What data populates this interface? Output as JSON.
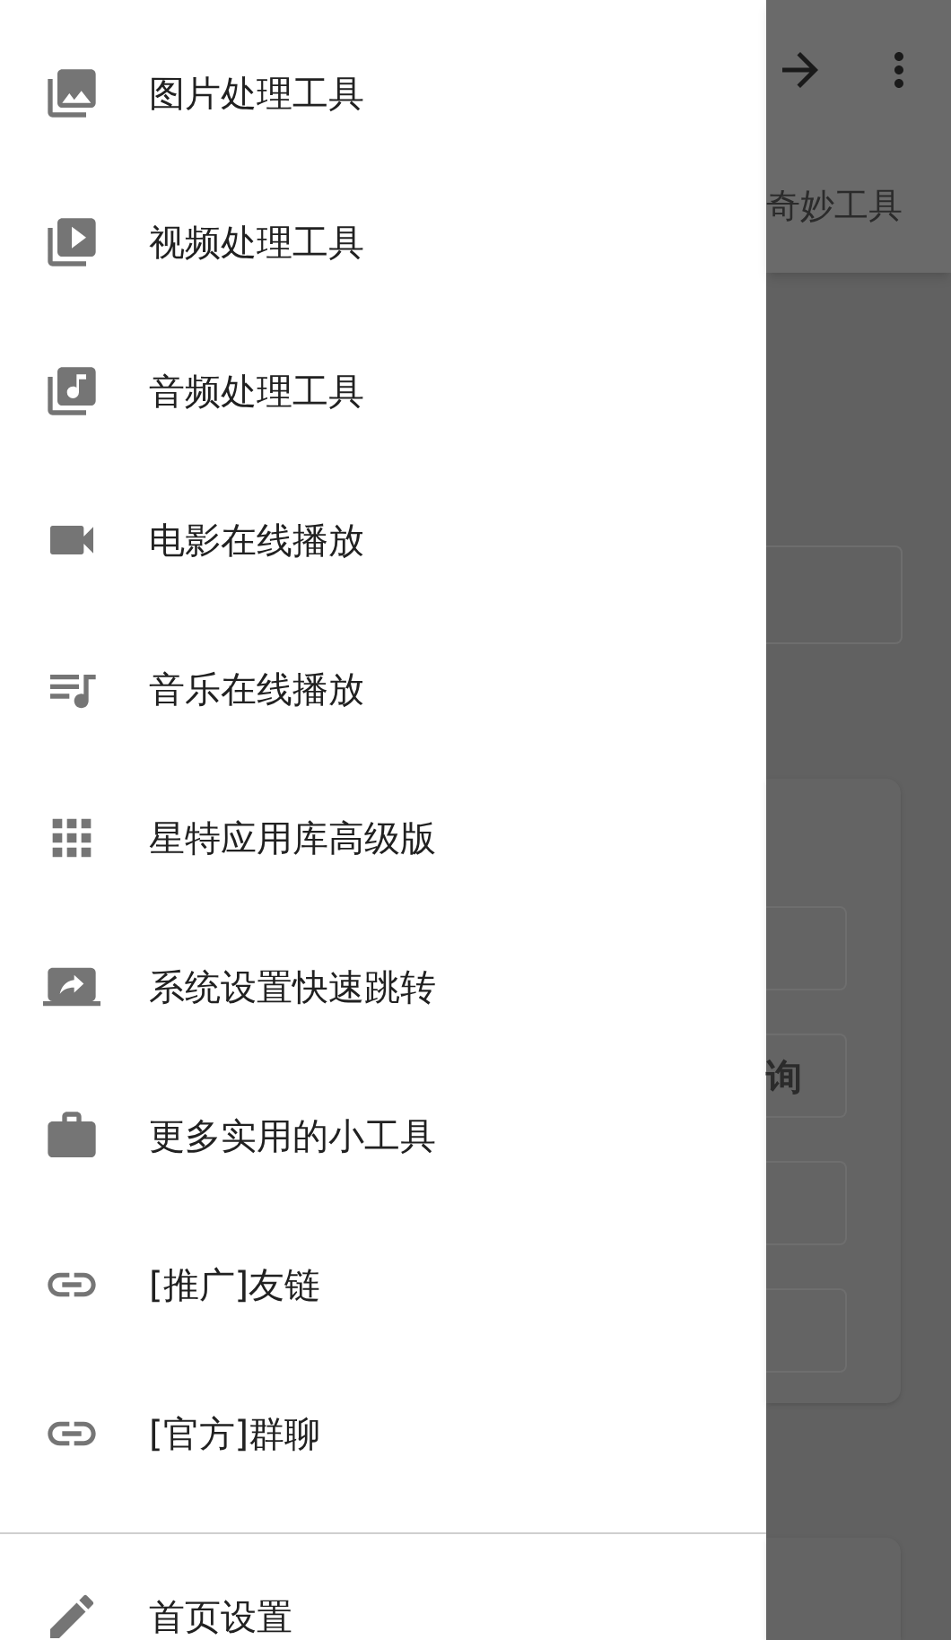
{
  "drawer": {
    "items": [
      {
        "label": "图片处理工具"
      },
      {
        "label": "视频处理工具"
      },
      {
        "label": "音频处理工具"
      },
      {
        "label": "电影在线播放"
      },
      {
        "label": "音乐在线播放"
      },
      {
        "label": "星特应用库高级版"
      },
      {
        "label": "系统设置快速跳转"
      },
      {
        "label": "更多实用的小工具"
      },
      {
        "label": "[推广]友链"
      },
      {
        "label": "[官方]群聊"
      }
    ],
    "footer_items": [
      {
        "label": "首页设置"
      }
    ]
  },
  "background": {
    "tab_label": "奇妙工具",
    "button_label": "询"
  }
}
